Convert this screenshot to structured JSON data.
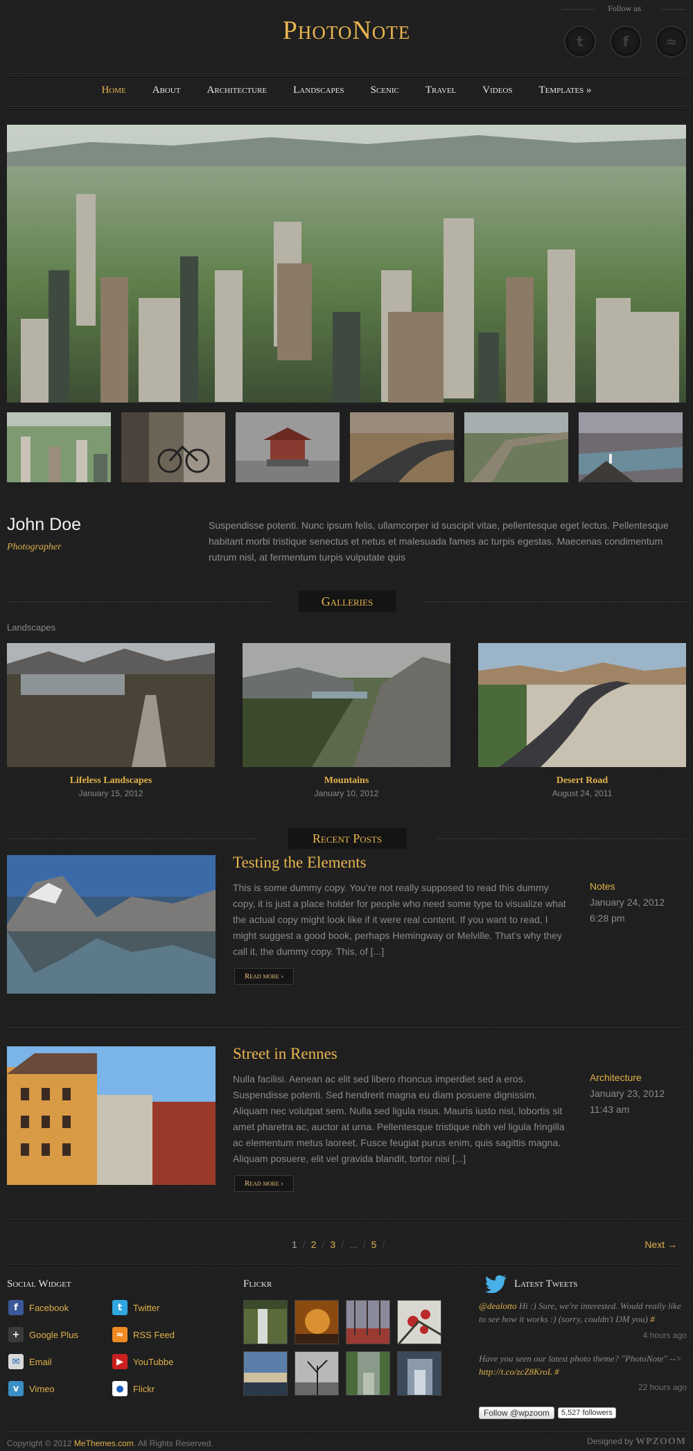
{
  "header": {
    "logo": "PhotoNote",
    "follow_label": "Follow us",
    "social": [
      {
        "name": "twitter-icon",
        "glyph": "t"
      },
      {
        "name": "facebook-icon",
        "glyph": "f"
      },
      {
        "name": "rss-icon",
        "glyph": "≈"
      }
    ]
  },
  "nav": {
    "items": [
      "Home",
      "About",
      "Architecture",
      "Landscapes",
      "Scenic",
      "Travel",
      "Videos",
      "Templates »"
    ],
    "active_index": 0
  },
  "bio": {
    "name": "John Doe",
    "role": "Photographer",
    "text": "Suspendisse potenti. Nunc ipsum felis, ullamcorper id suscipit vitae, pellentesque eget lectus. Pellentesque habitant morbi tristique senectus et netus et malesuada fames ac turpis egestas. Maecenas condimentum rutrum nisl, at fermentum turpis vulputate quis"
  },
  "galleries": {
    "heading": "Galleries",
    "subheading": "Landscapes",
    "items": [
      {
        "title": "Lifeless Landscapes",
        "date": "January 15, 2012"
      },
      {
        "title": "Mountains",
        "date": "January 10, 2012"
      },
      {
        "title": "Desert Road",
        "date": "August 24, 2011"
      }
    ]
  },
  "recent_posts": {
    "heading": "Recent Posts",
    "posts": [
      {
        "title": "Testing the Elements",
        "text": "This is some dummy copy. You’re not really supposed to read this dummy copy, it is just a place holder for people who need some type to visualize what the actual copy might look like if it were real content. If you want to read, I might suggest a good book, perhaps Hemingway or Melville. That’s why they call it, the dummy copy. This, of [...]",
        "read_more": "Read more ›",
        "category": "Notes",
        "date": "January 24, 2012",
        "time": "6:28 pm"
      },
      {
        "title": "Street in Rennes",
        "text": "Nulla facilisi. Aenean ac elit sed libero rhoncus imperdiet sed a eros. Suspendisse potenti. Sed hendrerit magna eu diam posuere dignissim. Aliquam nec volutpat sem. Nulla sed ligula risus. Mauris iusto nisl, lobortis sit amet pharetra ac, auctor at urna. Pellentesque tristique nibh vel ligula fringilla ac elementum metus laoreet. Fusce feugiat purus enim, quis sagittis magna. Aliquam posuere, elit vel gravida blandit, tortor nisi [...]",
        "read_more": "Read more ›",
        "category": "Architecture",
        "date": "January 23, 2012",
        "time": "11:43 am"
      }
    ]
  },
  "pagination": {
    "pages": [
      "1",
      "2",
      "3",
      "...",
      "5"
    ],
    "next": "Next →"
  },
  "footer": {
    "social_widget": {
      "title": "Social Widget",
      "links": [
        {
          "label": "Facebook",
          "icon": "facebook-icon",
          "color": "#3b5998",
          "glyph": "f"
        },
        {
          "label": "Twitter",
          "icon": "twitter-icon",
          "color": "#2fa8e0",
          "glyph": "t"
        },
        {
          "label": "Google Plus",
          "icon": "google-plus-icon",
          "color": "#3a3a3a",
          "glyph": "+"
        },
        {
          "label": "RSS Feed",
          "icon": "rss-icon",
          "color": "#f08a24",
          "glyph": "≈"
        },
        {
          "label": "Email",
          "icon": "email-icon",
          "color": "#d8d8d8",
          "glyph": "✉"
        },
        {
          "label": "YouTubbe",
          "icon": "youtube-icon",
          "color": "#cc2020",
          "glyph": "▶"
        },
        {
          "label": "Vimeo",
          "icon": "vimeo-icon",
          "color": "#3a8fc5",
          "glyph": "v"
        },
        {
          "label": "Flickr",
          "icon": "flickr-icon",
          "color": "#ffffff",
          "glyph": "●"
        }
      ]
    },
    "flickr": {
      "title": "Flickr"
    },
    "tweets": {
      "title": "Latest Tweets",
      "items": [
        {
          "handle": "@dealotto",
          "text": " Hi :) Sure, we're interested. Would really like to see how it works :) (sorry, couldn't DM you) ",
          "link": "#",
          "time": "4 hours ago"
        },
        {
          "handle": "",
          "text": "Have you seen our latest photo theme? \"PhotoNote\" --> ",
          "link": "http://t.co/zcZ8KroL #",
          "time": "22 hours ago"
        }
      ],
      "follow_button": "Follow @wpzoom",
      "followers": "5,527 followers"
    },
    "copyright_prefix": "Copyright © 2012 ",
    "copyright_link": "MeThemes.com",
    "copyright_suffix": ". All Rights Reserved.",
    "designed_by": "Designed by ",
    "designer": "WPZOOM"
  },
  "colors": {
    "accent": "#e9b650",
    "background": "#1e1e1e"
  }
}
